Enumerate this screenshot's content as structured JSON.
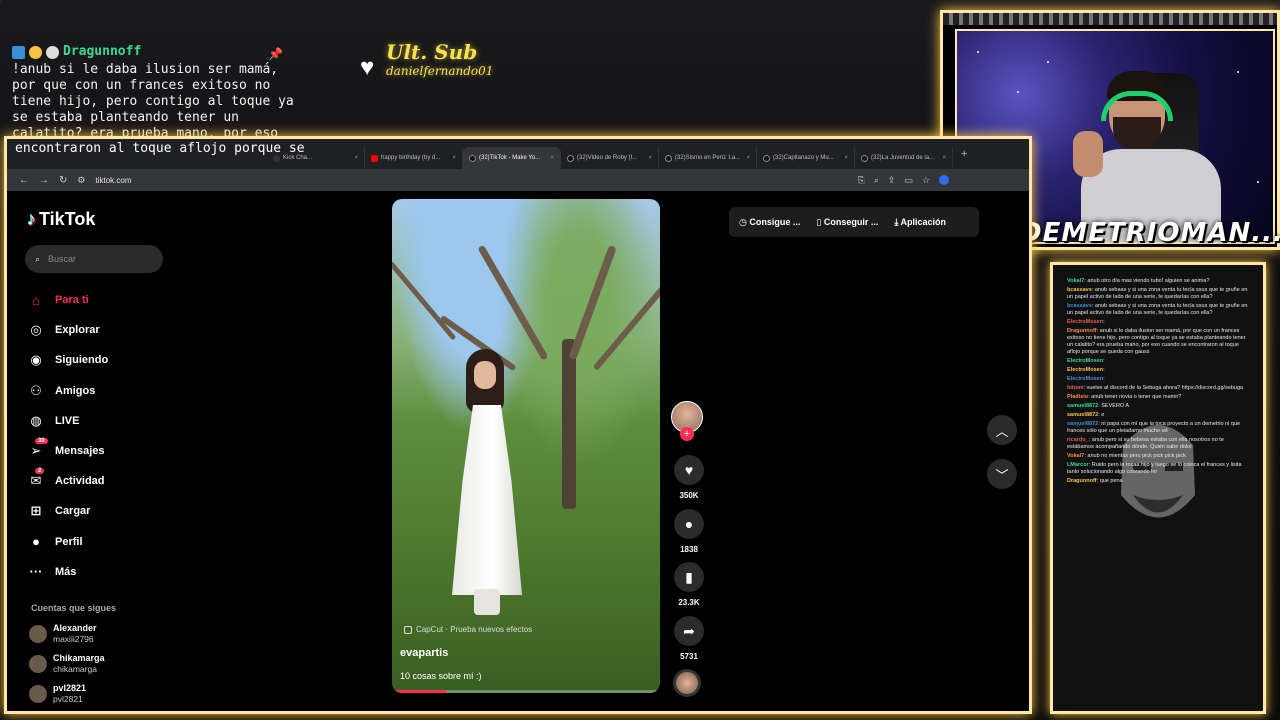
{
  "stream_chat": {
    "username": "Dragunnoff",
    "message": "!anub si le daba ilusion ser mamá, por que con un frances exitoso no tiene hijo, pero contigo al toque ya se estaba planteando tener un calatito? era prueba mano, por eso cuando se encontraron al toque aflojo porque se"
  },
  "last_sub": {
    "title": "Ult. Sub",
    "name": "danielfernando01"
  },
  "webcam": {
    "streamer_name": "DEMETRIOMAN...."
  },
  "browser": {
    "tabs": [
      {
        "label": "Kick Cha...",
        "icon": "kick"
      },
      {
        "label": "happy birthday (by d...",
        "icon": "youtube"
      },
      {
        "label": "(32)TikTok - Make Yo...",
        "icon": "tiktok",
        "active": true
      },
      {
        "label": "(32)Video de Roby (t...",
        "icon": "tiktok"
      },
      {
        "label": "(32)Sismo en Perú: La...",
        "icon": "tiktok"
      },
      {
        "label": "(32)Capitanazo y Mu...",
        "icon": "tiktok"
      },
      {
        "label": "(32)La Juventud de la...",
        "icon": "tiktok"
      }
    ],
    "url": "tiktok.com"
  },
  "tiktok": {
    "logo": "TikTok",
    "search_placeholder": "Buscar",
    "nav": [
      {
        "label": "Para ti",
        "icon": "home-icon",
        "active": true
      },
      {
        "label": "Explorar",
        "icon": "compass-icon"
      },
      {
        "label": "Siguiendo",
        "icon": "following-avatar-icon"
      },
      {
        "label": "Amigos",
        "icon": "friends-icon"
      },
      {
        "label": "LIVE",
        "icon": "live-icon"
      },
      {
        "label": "Mensajes",
        "icon": "messages-icon",
        "badge": "30"
      },
      {
        "label": "Actividad",
        "icon": "activity-icon",
        "badge": "2"
      },
      {
        "label": "Cargar",
        "icon": "upload-icon"
      },
      {
        "label": "Perfil",
        "icon": "profile-icon"
      },
      {
        "label": "Más",
        "icon": "more-icon"
      }
    ],
    "following_title": "Cuentas que sigues",
    "following": [
      {
        "name": "Alexander",
        "handle": "maxiii2796"
      },
      {
        "name": "Chikamarga",
        "handle": "chikamarga"
      },
      {
        "name": "pvl2821",
        "handle": "pvl2821"
      }
    ],
    "top_actions": [
      "Consigue ...",
      "Conseguir ...",
      "Aplicación"
    ],
    "video": {
      "effect": "CapCut · Prueba nuevos efectos",
      "author": "evapartis",
      "caption": "10 cosas sobre mí :)",
      "progress": 0.2
    },
    "actions": {
      "likes": "350K",
      "comments": "1838",
      "saves": "23.3K",
      "shares": "5731"
    }
  },
  "chat_panel": {
    "messages": [
      {
        "user": "Vokal7",
        "text": "anub otro día mas viendo tubo! alguien se anima?"
      },
      {
        "user": "bcassavs",
        "text": "anub sebaas y si una zona venta tu tecla ssus que te gruñe en un papel activo de lado de una serie, te quedarías con ella?"
      },
      {
        "user": "bcassavs",
        "text": "anub sebaas y si una zona venta tu tecla ssus que te gruñe en un papel activo de lado de una serie, te quedarías con ella?"
      },
      {
        "user": "ElectroMosen",
        "text": ""
      },
      {
        "user": "Dragunnoff",
        "text": "anub si le daba ilusion ser mamá, por que con un frances exitoso no tiene hijo, pero contigo al toque ya se estaba planteando tener un calatito? era prueba mano, por eso cuando se encontraron al toque aflojo porque se queda con gauss"
      },
      {
        "user": "ElectroMosen",
        "text": ""
      },
      {
        "user": "ElectroMosen",
        "text": ""
      },
      {
        "user": "ElectroMosen",
        "text": ""
      },
      {
        "user": "hitomi",
        "text": "vuelve al discord de la Sebuga ahora? https://discord.gg/sebuga"
      },
      {
        "user": "Pladisio",
        "text": "anub tener novia o tener que mamir?"
      },
      {
        "user": "samuel8872",
        "text": "SEVERO A"
      },
      {
        "user": "samuel8872",
        "text": "e"
      },
      {
        "user": "samuel8872",
        "text": "ni papa con mí que la toca proyecto a un demetrio ni que frances sólo que un pleiadamo mucho ud"
      },
      {
        "user": "ricardo_",
        "text": "anub pero si su bebesa estaba con ella nosotros no te estábamos acompañando dónde. Quién sabe dolor"
      },
      {
        "user": "Vokal7",
        "text": "anub no mientas pero pick pick pick pick"
      },
      {
        "user": "LMarcor",
        "text": "Ruido pero la tocaa hijo y luego se lo coloca el frances y lisita tanto solucionando algo cobrando ler"
      },
      {
        "user": "Dragunnoff",
        "text": "que pena"
      }
    ]
  }
}
